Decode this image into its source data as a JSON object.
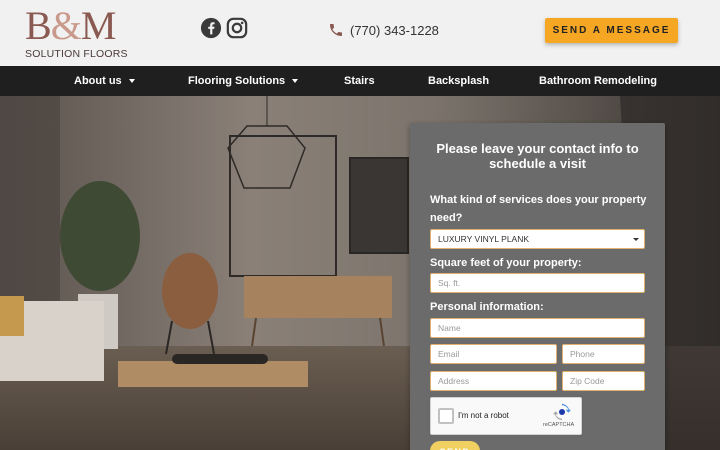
{
  "header": {
    "logo_main": "B&M",
    "logo_sub": "SOLUTION FLOORS",
    "phone": "(770) 343-1228",
    "cta_label": "SEND A MESSAGE",
    "social": [
      "facebook-icon",
      "instagram-icon"
    ],
    "colors": {
      "cta": "#f5a623",
      "logo": "#8a5a52",
      "nav": "#1f1f1f"
    }
  },
  "nav": {
    "items": [
      {
        "label": "About us",
        "has_dropdown": true
      },
      {
        "label": "Flooring Solutions",
        "has_dropdown": true
      },
      {
        "label": "Stairs",
        "has_dropdown": false
      },
      {
        "label": "Backsplash",
        "has_dropdown": false
      },
      {
        "label": "Bathroom Remodeling",
        "has_dropdown": false
      }
    ]
  },
  "form": {
    "title": "Please leave your contact info to schedule a visit",
    "services_label": "What kind of services does your property need?",
    "services_value": "LUXURY VINYL PLANK",
    "sqft_label": "Square feet of your property:",
    "sqft_placeholder": "Sq. ft.",
    "personal_label": "Personal information:",
    "name_placeholder": "Name",
    "email_placeholder": "Email",
    "phone_placeholder": "Phone",
    "address_placeholder": "Address",
    "zip_placeholder": "Zip Code",
    "recaptcha_label": "I'm not a robot",
    "recaptcha_brand": "reCAPTCHA",
    "submit_label": "SEND"
  }
}
